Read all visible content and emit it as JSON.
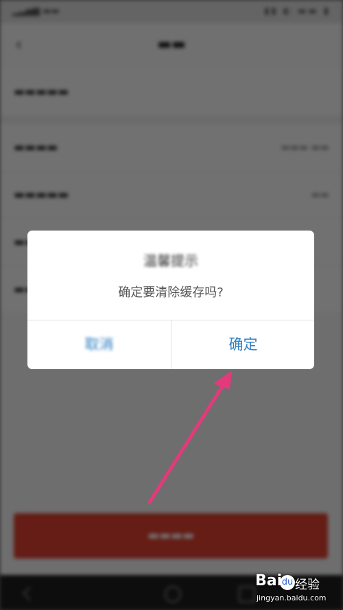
{
  "dialog": {
    "title": "温馨提示",
    "message": "确定要清除缓存吗?",
    "cancel_label": "取消",
    "confirm_label": "确定"
  },
  "colors": {
    "confirm_text": "#2f7fc1",
    "arrow": "#e23a7a",
    "logout_button": "#e04030"
  },
  "watermark": {
    "brand": "Bai",
    "brand_suffix": "经验",
    "paw_glyph": "du",
    "url": "jingyan.baidu.com"
  },
  "icons": {
    "back": "back-arrow-icon",
    "nav_back": "nav-back-icon",
    "nav_home": "nav-home-icon",
    "nav_recent": "nav-recent-icon"
  }
}
